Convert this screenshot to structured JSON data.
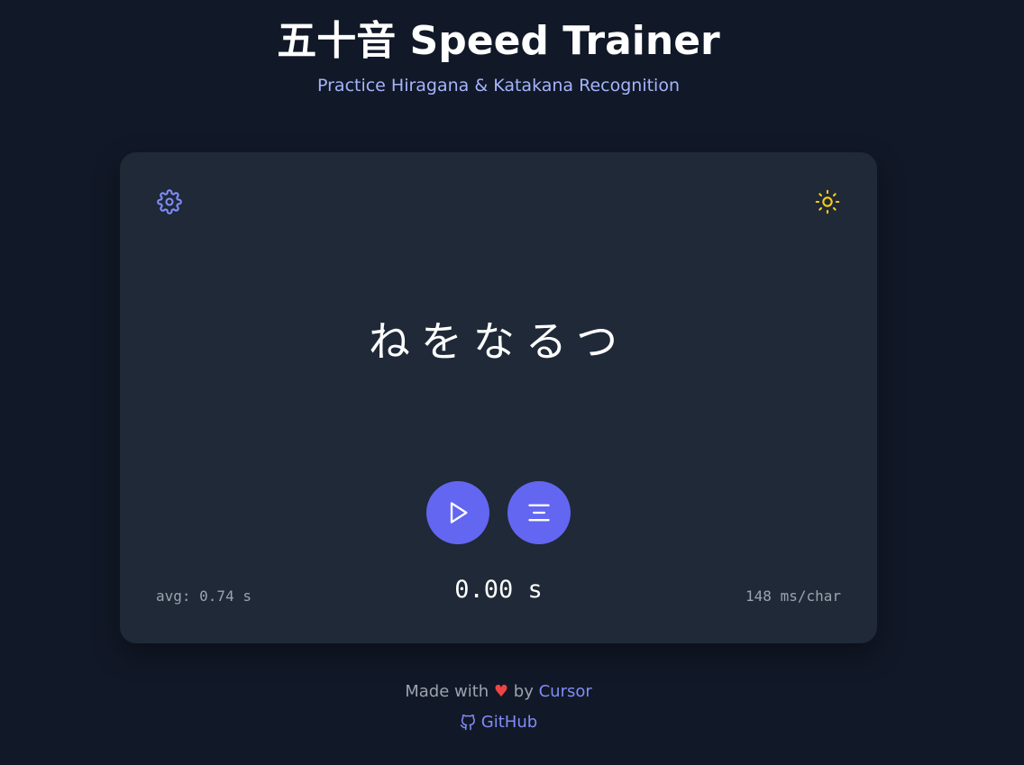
{
  "header": {
    "title": "五十音 Speed Trainer",
    "subtitle": "Practice Hiragana & Katakana Recognition"
  },
  "trainer": {
    "settings_icon": "gear-icon",
    "theme_icon": "sun-icon",
    "kana_sequence": "ねをなるつ",
    "play_icon": "play-icon",
    "menu_icon": "align-center-icon",
    "avg_label": "avg: 0.74 s",
    "timer": "0.00 s",
    "rate": "148 ms/char"
  },
  "footer": {
    "made_with": "Made with",
    "heart": "♥",
    "by": "by",
    "cursor_link": "Cursor",
    "github_link": "GitHub"
  },
  "colors": {
    "background": "#111827",
    "card": "#1f2937",
    "accent": "#6366f1",
    "subtitle": "#a5b4fc",
    "link": "#818cf8",
    "heart": "#ef4444",
    "sun": "#facc15"
  }
}
